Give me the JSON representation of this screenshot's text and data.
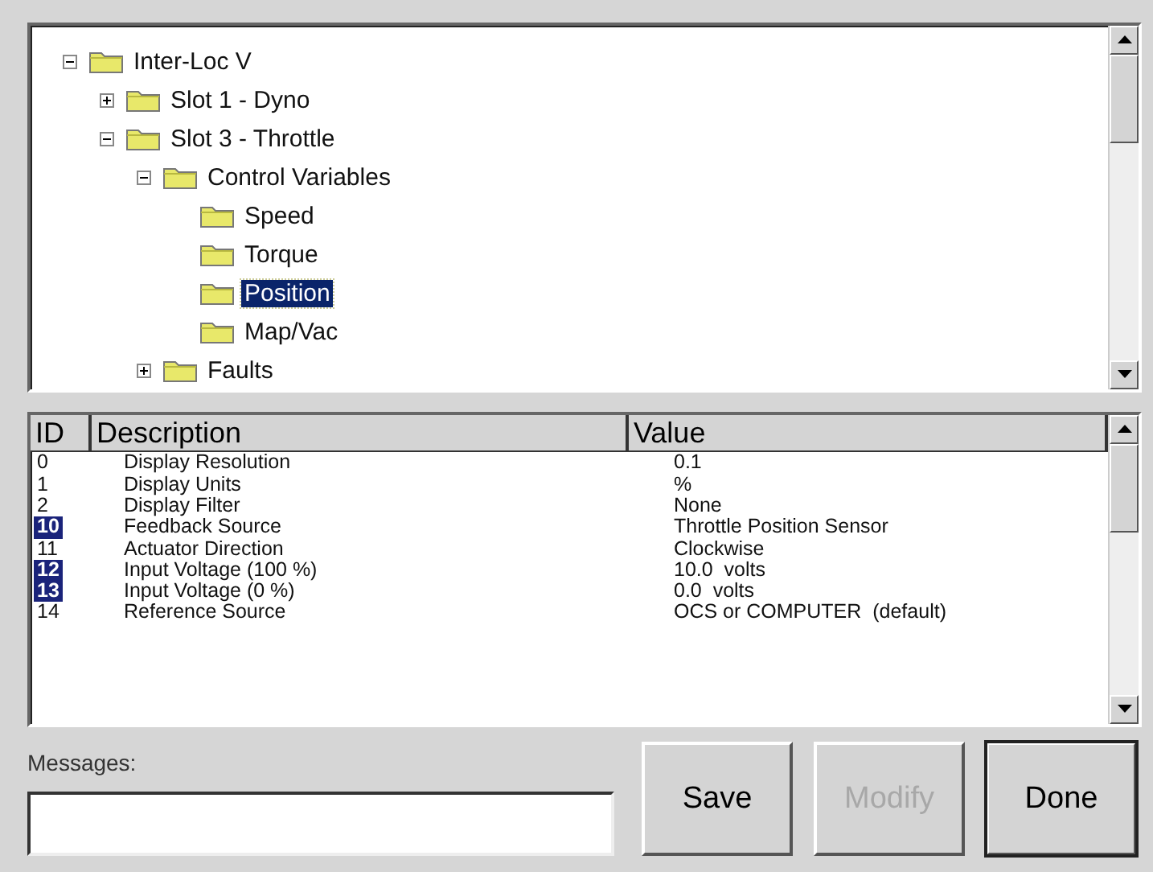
{
  "tree": [
    {
      "label": "Inter-Loc V",
      "selected": false,
      "expanded": true,
      "children": [
        {
          "label": "Slot 1 - Dyno",
          "selected": false,
          "expanded": false
        },
        {
          "label": "Slot 3 - Throttle",
          "selected": false,
          "expanded": true,
          "children": [
            {
              "label": "Control Variables",
              "selected": false,
              "expanded": true,
              "children": [
                {
                  "label": "Speed",
                  "selected": false
                },
                {
                  "label": "Torque",
                  "selected": false
                },
                {
                  "label": "Position",
                  "selected": true
                },
                {
                  "label": "Map/Vac",
                  "selected": false
                }
              ]
            },
            {
              "label": "Faults",
              "selected": false,
              "expanded": false
            }
          ]
        }
      ]
    }
  ],
  "table": {
    "columns": [
      "ID",
      "Description",
      "Value"
    ],
    "rows": [
      {
        "id": "0",
        "description": "Display Resolution",
        "value": "0.1",
        "highlighted": false
      },
      {
        "id": "1",
        "description": "Display Units",
        "value": "%",
        "highlighted": false
      },
      {
        "id": "2",
        "description": "Display Filter",
        "value": "None",
        "highlighted": false
      },
      {
        "id": "10",
        "description": "Feedback Source",
        "value": "Throttle Position Sensor",
        "highlighted": true
      },
      {
        "id": "11",
        "description": "Actuator Direction",
        "value": "Clockwise",
        "highlighted": false
      },
      {
        "id": "12",
        "description": "Input Voltage (100 %)",
        "value": "10.0  volts",
        "highlighted": true
      },
      {
        "id": "13",
        "description": "Input Voltage (0 %)",
        "value": "0.0  volts",
        "highlighted": true
      },
      {
        "id": "14",
        "description": "Reference Source",
        "value": "OCS or COMPUTER  (default)",
        "highlighted": false
      }
    ]
  },
  "messages": {
    "label": "Messages:"
  },
  "buttons": [
    {
      "label": "Save",
      "disabled": false
    },
    {
      "label": "Modify",
      "disabled": true
    },
    {
      "label": "Done",
      "disabled": false
    }
  ]
}
